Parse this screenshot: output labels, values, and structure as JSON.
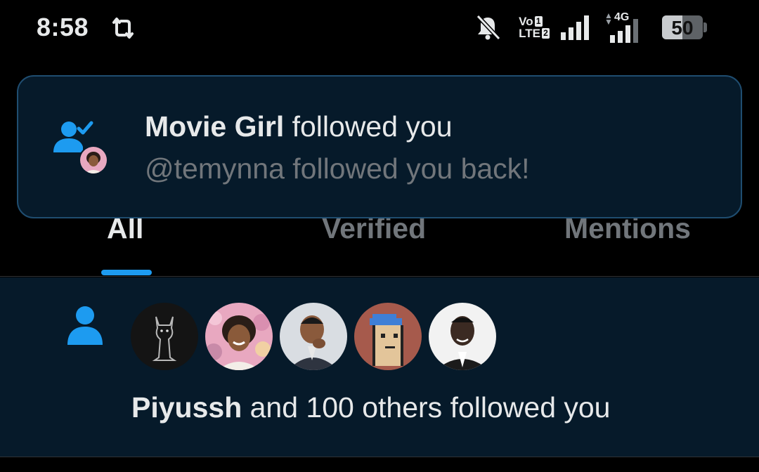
{
  "status_bar": {
    "time": "8:58",
    "volte_top": "Vo",
    "volte_bottom": "LTE",
    "sim_slot_top": "1",
    "sim_slot_bottom": "2",
    "network": "4G",
    "battery": "50",
    "battery_level": 0.5
  },
  "toast": {
    "name": "Movie Girl",
    "action": " followed you",
    "subtitle": "@temynna followed you back!",
    "accent_color": "#1d9bf0"
  },
  "tabs": [
    {
      "label": "All",
      "active": true
    },
    {
      "label": "Verified",
      "active": false
    },
    {
      "label": "Mentions",
      "active": false
    }
  ],
  "notification": {
    "name": "Piyussh",
    "rest": " and 100 others followed you",
    "avatar_icons": [
      "cat-statue-avatar",
      "woman-flowers-avatar",
      "man-thinking-avatar",
      "pixel-punk-avatar",
      "man-suit-avatar"
    ]
  },
  "colors": {
    "accent": "#1d9bf0",
    "background": "#000000",
    "card": "#061a2a"
  }
}
